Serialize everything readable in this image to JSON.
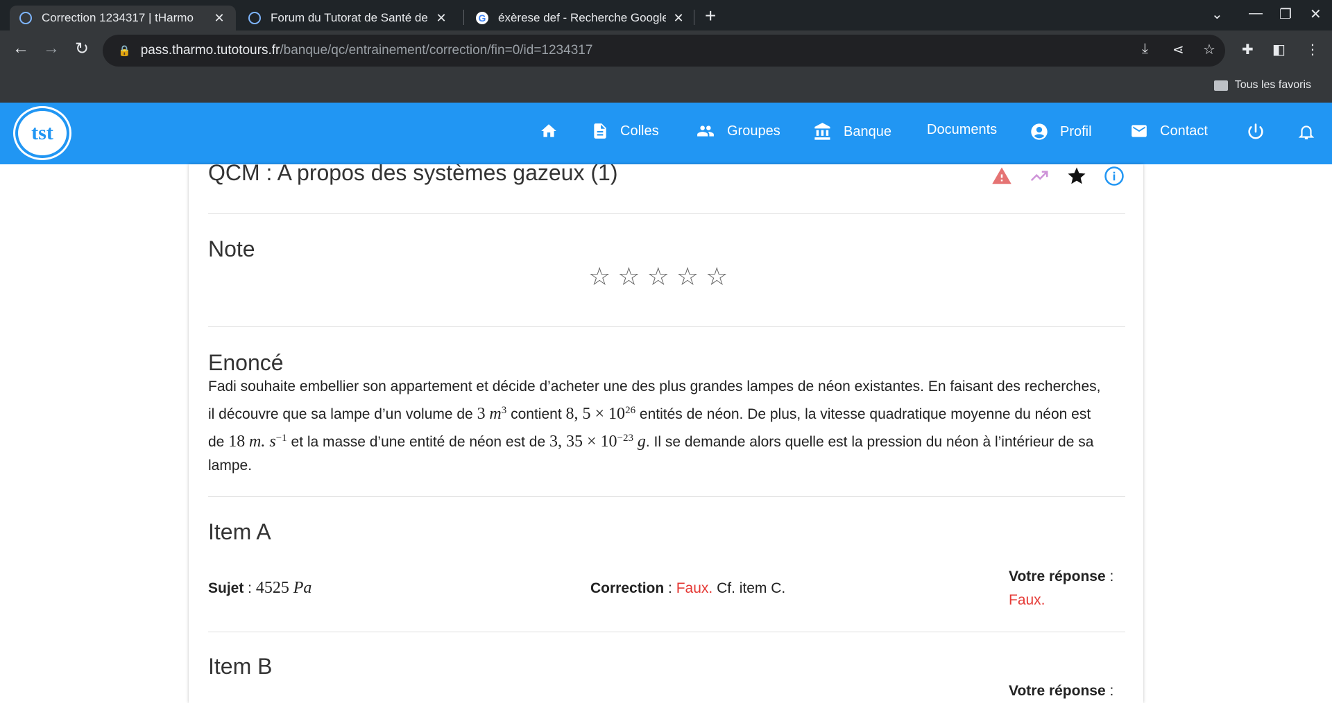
{
  "browser": {
    "tabs": [
      {
        "title": "Correction 1234317 | tHarmo",
        "active": true
      },
      {
        "title": "Forum du Tutorat de Santé de To",
        "active": false
      },
      {
        "title": "éxèrese def - Recherche Google",
        "active": false
      }
    ],
    "url_host": "pass.tharmo.tutotours.fr",
    "url_path": "/banque/qc/entrainement/correction/fin=0/id=1234317",
    "bookmarks_label": "Tous les favoris"
  },
  "nav": {
    "logo": "tst",
    "items": [
      {
        "label": "",
        "icon": "home-icon"
      },
      {
        "label": "Colles",
        "icon": "document-icon"
      },
      {
        "label": "Groupes",
        "icon": "people-icon"
      },
      {
        "label": "Banque",
        "icon": "bank-icon"
      },
      {
        "label": "Documents",
        "icon": ""
      },
      {
        "label": "Profil",
        "icon": "account-icon"
      },
      {
        "label": "Contact",
        "icon": "mail-icon"
      }
    ]
  },
  "qcm": {
    "title": "QCM : A propos des systèmes gazeux (1)",
    "note_title": "Note",
    "rating": 0,
    "rating_max": 5,
    "enonce_title": "Enoncé",
    "enonce": {
      "p1": "Fadi souhaite embellier son appartement et décide d’acheter une des plus grandes lampes de néon existantes. En faisant des recherches, il découvre que sa lampe d’un volume de",
      "v1": "3",
      "u1": "m",
      "u1_exp": "3",
      "p2": "contient",
      "v2": "8, 5 × 10",
      "v2_exp": "26",
      "p3": "entités de néon. De plus, la vitesse quadratique moyenne du néon est de",
      "v3": "18",
      "u3": "m. s",
      "u3_exp": "−1",
      "p4": "et la masse d’une entité de néon est de",
      "v4": "3, 35 × 10",
      "v4_exp": "−23",
      "u4": "g",
      "p5": ". Il se demande alors quelle est la pression du néon à l’intérieur de sa lampe."
    },
    "items": [
      {
        "title": "Item A",
        "sujet_label": "Sujet",
        "sujet_value": "4525",
        "sujet_unit": "Pa",
        "correction_label": "Correction",
        "correction_value": "Faux.",
        "correction_note": "Cf. item C.",
        "reponse_label": "Votre réponse",
        "reponse_value": "Faux."
      },
      {
        "title": "Item B",
        "reponse_label": "Votre réponse"
      }
    ]
  }
}
